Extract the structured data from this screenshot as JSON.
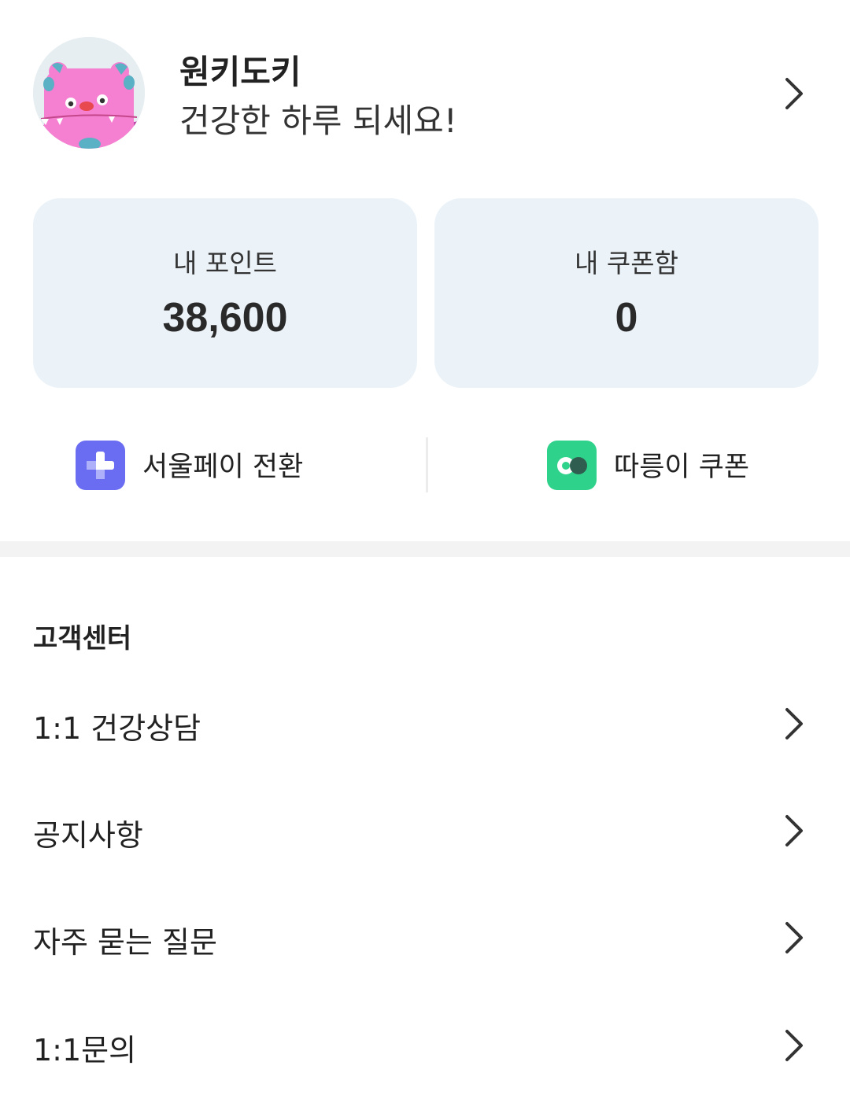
{
  "profile": {
    "name": "원키도키",
    "greeting": "건강한 하루 되세요!",
    "avatar_icon": "pink-monster-avatar",
    "chevron_icon": "chevron-right-icon"
  },
  "stats": {
    "points": {
      "label": "내 포인트",
      "value": "38,600"
    },
    "coupons": {
      "label": "내 쿠폰함",
      "value": "0"
    }
  },
  "quick_actions": [
    {
      "label": "서울페이 전환",
      "icon": "seoulpay-icon",
      "color": "#6a6cf2"
    },
    {
      "label": "따릉이 쿠폰",
      "icon": "ddareungi-bike-icon",
      "color": "#2fd28a"
    }
  ],
  "customer_center": {
    "title": "고객센터",
    "items": [
      {
        "label": "1:1 건강상담"
      },
      {
        "label": "공지사항"
      },
      {
        "label": "자주 묻는 질문"
      },
      {
        "label": "1:1문의"
      }
    ]
  },
  "colors": {
    "card_background": "#ebf3f9",
    "divider_band": "#f3f3f3",
    "seoulpay_brand": "#6a6cf2",
    "ddareungi_brand": "#2fd28a"
  }
}
